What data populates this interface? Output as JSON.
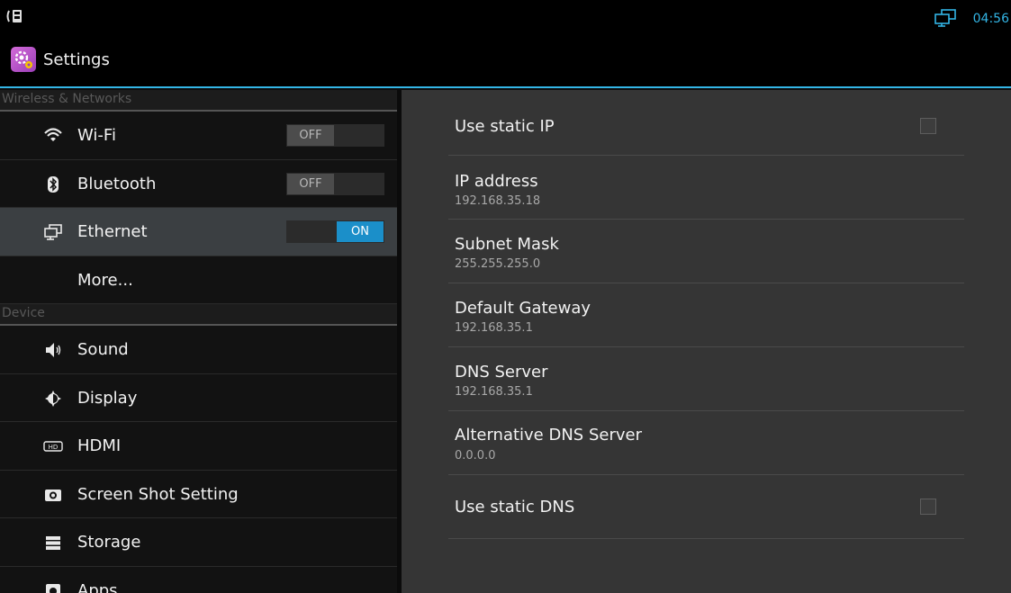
{
  "status_bar": {
    "time": "04:56",
    "left_icon": "usb-debug-icon",
    "right_icon": "ethernet-status-icon"
  },
  "action_bar": {
    "title": "Settings",
    "icon": "settings-app-icon"
  },
  "left_panel": {
    "sections": [
      {
        "header": "Wireless & Networks",
        "items": [
          {
            "label": "Wi-Fi",
            "icon": "wifi-icon",
            "toggle": "OFF"
          },
          {
            "label": "Bluetooth",
            "icon": "bluetooth-icon",
            "toggle": "OFF"
          },
          {
            "label": "Ethernet",
            "icon": "ethernet-icon",
            "toggle": "ON",
            "selected": true
          },
          {
            "label": "More...",
            "icon": ""
          }
        ]
      },
      {
        "header": "Device",
        "items": [
          {
            "label": "Sound",
            "icon": "sound-icon"
          },
          {
            "label": "Display",
            "icon": "display-icon"
          },
          {
            "label": "HDMI",
            "icon": "hdmi-icon"
          },
          {
            "label": "Screen Shot Setting",
            "icon": "camera-icon"
          },
          {
            "label": "Storage",
            "icon": "storage-icon"
          },
          {
            "label": "Apps",
            "icon": "apps-icon"
          }
        ]
      }
    ]
  },
  "right_panel": {
    "use_static_ip": {
      "label": "Use static IP",
      "checked": false
    },
    "ip_address": {
      "label": "IP address",
      "value": "192.168.35.18"
    },
    "subnet_mask": {
      "label": "Subnet Mask",
      "value": "255.255.255.0"
    },
    "default_gateway": {
      "label": "Default Gateway",
      "value": "192.168.35.1"
    },
    "dns_server": {
      "label": "DNS Server",
      "value": "192.168.35.1"
    },
    "alt_dns_server": {
      "label": "Alternative DNS Server",
      "value": "0.0.0.0"
    },
    "use_static_dns": {
      "label": "Use static DNS",
      "checked": false
    }
  },
  "colors": {
    "accent": "#33b5e5",
    "toggle_on": "#1b8fc9",
    "panel_bg": "#353535",
    "selected_bg": "#3b3f42"
  }
}
